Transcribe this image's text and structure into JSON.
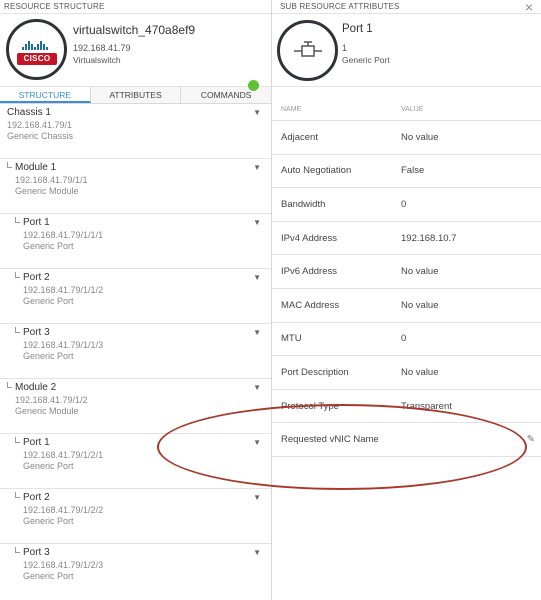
{
  "left_panel": {
    "title": "RESOURCE STRUCTURE",
    "device": {
      "name": "virtualswitch_470a8ef9",
      "ip": "192.168.41.79",
      "type": "Virtualswitch",
      "logo_text": "CISCO",
      "status_color": "#5ec233"
    },
    "tabs": [
      {
        "label": "STRUCTURE",
        "active": true
      },
      {
        "label": "ATTRIBUTES",
        "active": false
      },
      {
        "label": "COMMANDS",
        "active": false
      }
    ],
    "tree": [
      {
        "name": "Chassis 1",
        "ip": "192.168.41.79/1",
        "type": "Generic Chassis",
        "level": 0
      },
      {
        "name": "Module 1",
        "ip": "192.168.41.79/1/1",
        "type": "Generic Module",
        "level": 1
      },
      {
        "name": "Port 1",
        "ip": "192.168.41.79/1/1/1",
        "type": "Generic Port",
        "level": 2
      },
      {
        "name": "Port 2",
        "ip": "192.168.41.79/1/1/2",
        "type": "Generic Port",
        "level": 2
      },
      {
        "name": "Port 3",
        "ip": "192.168.41.79/1/1/3",
        "type": "Generic Port",
        "level": 2
      },
      {
        "name": "Module 2",
        "ip": "192.168.41.79/1/2",
        "type": "Generic Module",
        "level": 1
      },
      {
        "name": "Port 1",
        "ip": "192.168.41.79/1/2/1",
        "type": "Generic Port",
        "level": 2
      },
      {
        "name": "Port 2",
        "ip": "192.168.41.79/1/2/2",
        "type": "Generic Port",
        "level": 2
      },
      {
        "name": "Port 3",
        "ip": "192.168.41.79/1/2/3",
        "type": "Generic Port",
        "level": 2
      }
    ]
  },
  "right_panel": {
    "title": "SUB RESOURCE ATTRIBUTES",
    "close_glyph": "×",
    "port": {
      "name": "Port 1",
      "number": "1",
      "type": "Generic Port"
    },
    "columns": {
      "name": "NAME",
      "value": "VALUE"
    },
    "attributes": [
      {
        "name": "Adjacent",
        "value": "No value"
      },
      {
        "name": "Auto Negotiation",
        "value": "False"
      },
      {
        "name": "Bandwidth",
        "value": "0"
      },
      {
        "name": "IPv4 Address",
        "value": "192.168.10.7"
      },
      {
        "name": "IPv6 Address",
        "value": "No value"
      },
      {
        "name": "MAC Address",
        "value": "No value"
      },
      {
        "name": "MTU",
        "value": "0"
      },
      {
        "name": "Port Description",
        "value": "No value"
      },
      {
        "name": "Protocol Type",
        "value": "Transparent"
      },
      {
        "name": "Requested vNIC Name",
        "value": ""
      }
    ]
  },
  "accent_color": "#3a8fd6",
  "annotation_color": "#a7392a"
}
